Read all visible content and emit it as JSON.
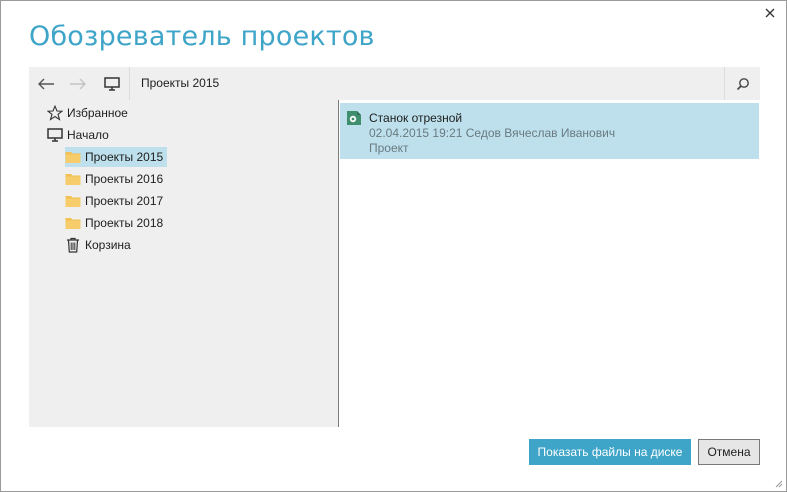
{
  "window": {
    "title": "Обозреватель проектов",
    "close_icon": "close-icon"
  },
  "toolbar": {
    "back_icon": "arrow-left-icon",
    "forward_icon": "arrow-right-icon",
    "home_icon": "monitor-icon",
    "path": "Проекты 2015",
    "search_icon": "search-icon"
  },
  "tree": {
    "items": [
      {
        "label": "Избранное",
        "icon": "star-icon",
        "selected": false
      },
      {
        "label": "Начало",
        "icon": "monitor-icon",
        "selected": false
      },
      {
        "label": "Проекты 2015",
        "icon": "folder-icon",
        "selected": true
      },
      {
        "label": "Проекты 2016",
        "icon": "folder-icon",
        "selected": false
      },
      {
        "label": "Проекты 2017",
        "icon": "folder-icon",
        "selected": false
      },
      {
        "label": "Проекты 2018",
        "icon": "folder-icon",
        "selected": false
      },
      {
        "label": "Корзина",
        "icon": "trash-icon",
        "selected": false
      }
    ]
  },
  "list": {
    "items": [
      {
        "name": "Станок отрезной",
        "meta": "02.04.2015 19:21 Седов Вячеслав Иванович",
        "kind": "Проект",
        "icon": "project-document-icon",
        "selected": true
      }
    ]
  },
  "footer": {
    "show_files_label": "Показать файлы на диске",
    "cancel_label": "Отмена"
  },
  "colors": {
    "accent": "#3ea4c8",
    "selection": "#bde0ec",
    "pane_bg": "#efefef",
    "folder": "#f2c053",
    "doc_green": "#3f8f6e"
  }
}
